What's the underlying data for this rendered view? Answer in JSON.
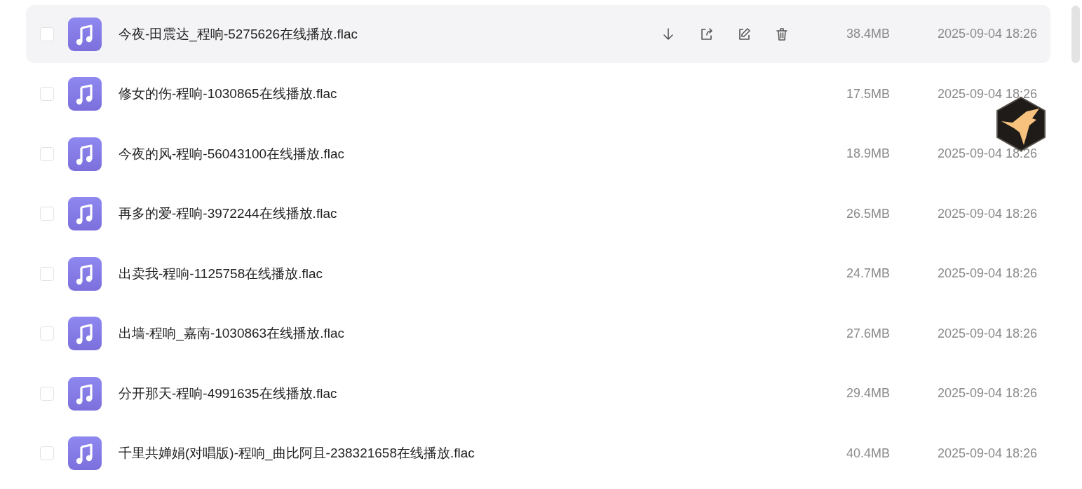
{
  "files": [
    {
      "name": "今夜-田震达_程响-5275626在线播放.flac",
      "size": "38.4MB",
      "date": "2025-09-04 18:26",
      "checked": false,
      "hovered": true
    },
    {
      "name": "修女的伤-程响-1030865在线播放.flac",
      "size": "17.5MB",
      "date": "2025-09-04 18:26",
      "checked": false,
      "hovered": false
    },
    {
      "name": "今夜的风-程响-56043100在线播放.flac",
      "size": "18.9MB",
      "date": "2025-09-04 18:26",
      "checked": false,
      "hovered": false
    },
    {
      "name": "再多的爱-程响-3972244在线播放.flac",
      "size": "26.5MB",
      "date": "2025-09-04 18:26",
      "checked": false,
      "hovered": false
    },
    {
      "name": "出卖我-程响-1125758在线播放.flac",
      "size": "24.7MB",
      "date": "2025-09-04 18:26",
      "checked": false,
      "hovered": false
    },
    {
      "name": "出墙-程响_嘉南-1030863在线播放.flac",
      "size": "27.6MB",
      "date": "2025-09-04 18:26",
      "checked": false,
      "hovered": false
    },
    {
      "name": "分开那天-程响-4991635在线播放.flac",
      "size": "29.4MB",
      "date": "2025-09-04 18:26",
      "checked": false,
      "hovered": false
    },
    {
      "name": "千里共婵娟(对唱版)-程响_曲比阿且-238321658在线播放.flac",
      "size": "40.4MB",
      "date": "2025-09-04 18:26",
      "checked": false,
      "hovered": false
    }
  ]
}
